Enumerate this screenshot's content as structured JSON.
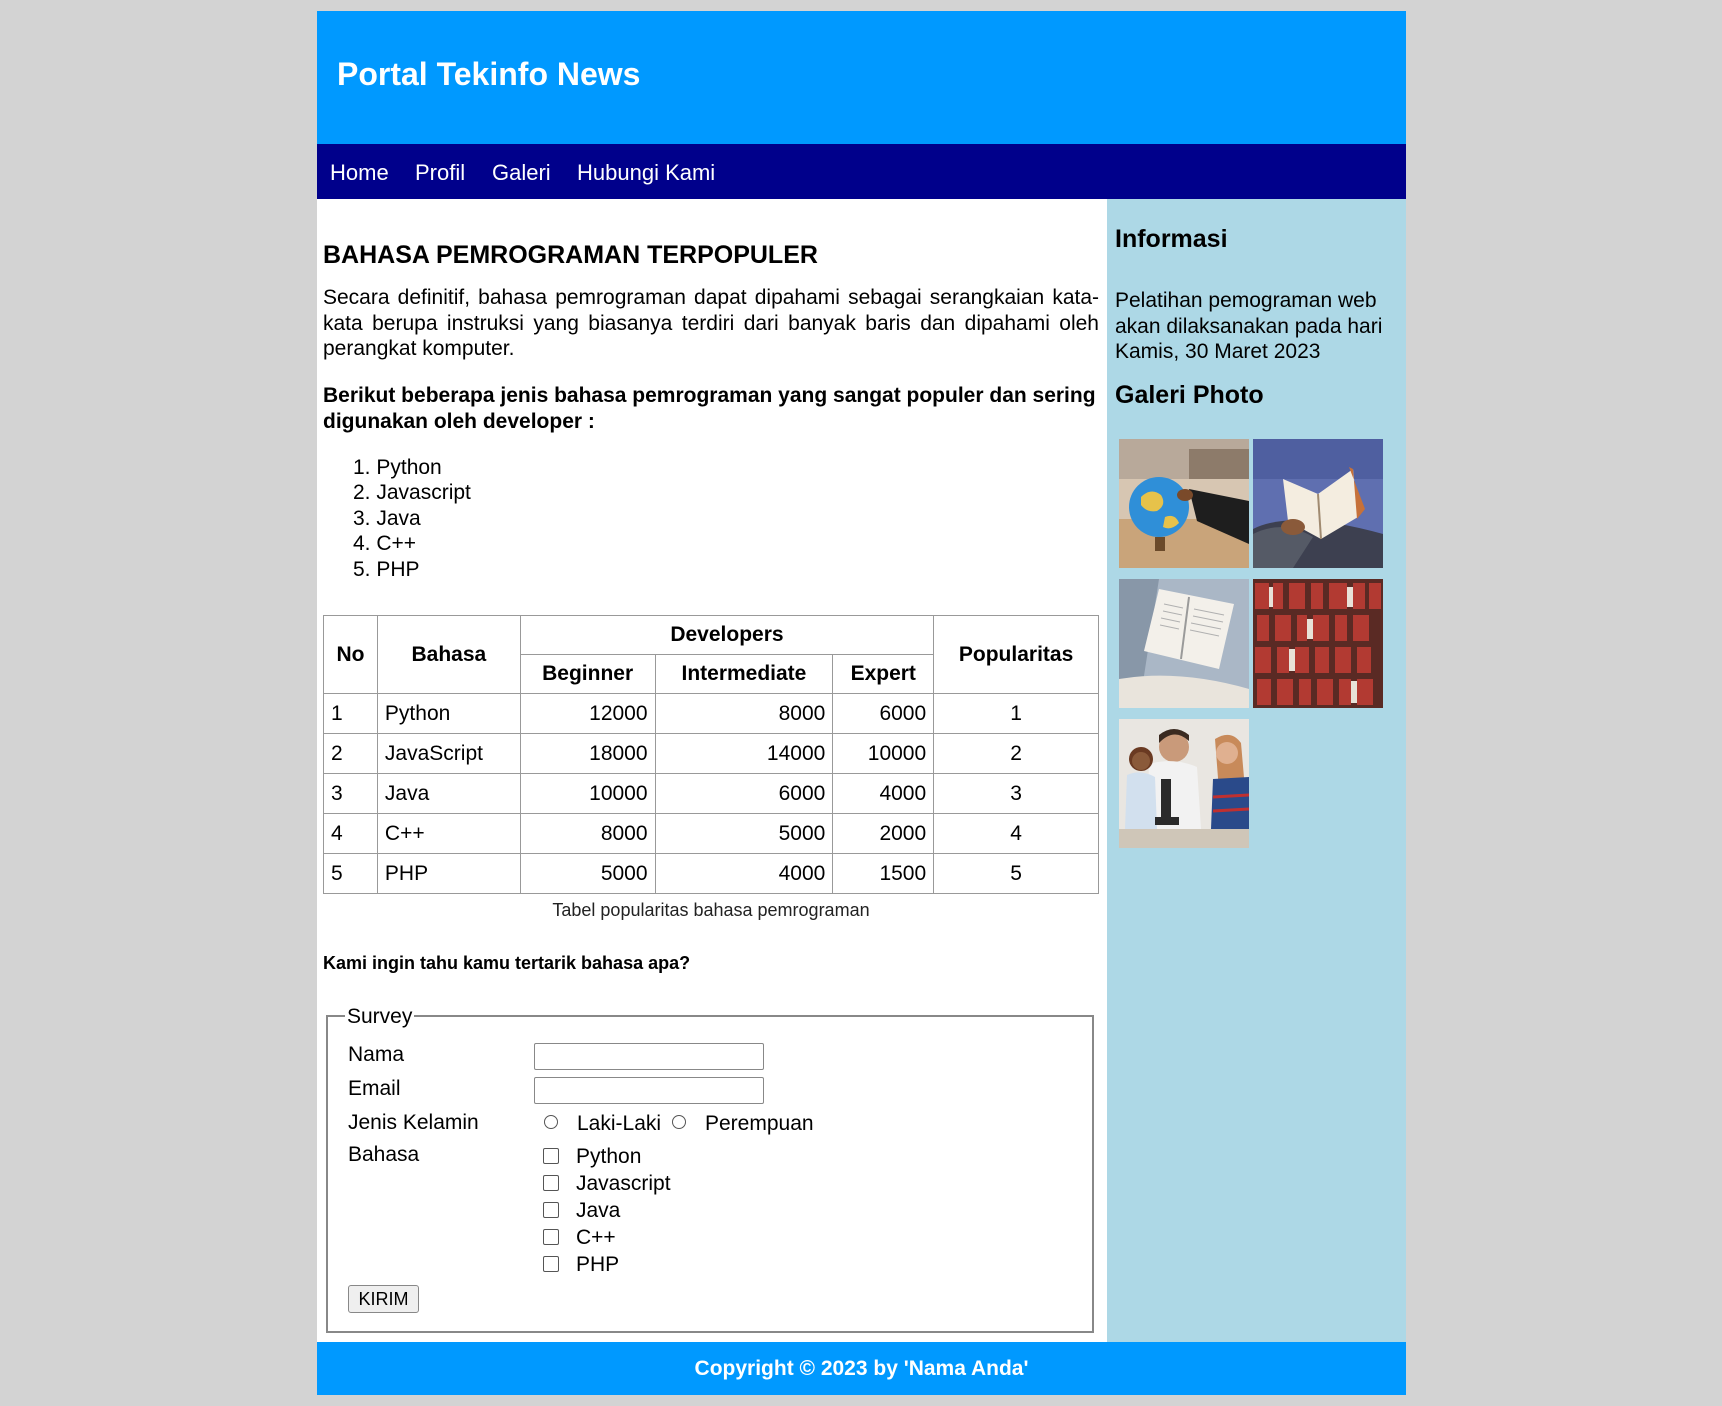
{
  "header": {
    "title": "Portal Tekinfo News"
  },
  "nav": {
    "items": [
      "Home",
      "Profil",
      "Galeri",
      "Hubungi Kami"
    ]
  },
  "article": {
    "title": "BAHASA PEMROGRAMAN TERPOPULER",
    "intro": "Secara definitif, bahasa pemrograman dapat dipahami sebagai serangkaian kata-kata berupa instruksi yang biasanya terdiri dari banyak baris dan dipahami oleh perangkat komputer.",
    "lead": "Berikut beberapa jenis bahasa pemrograman yang sangat populer dan sering digunakan oleh developer :",
    "list": [
      "1. Python",
      "2. Javascript",
      "3. Java",
      "4. C++",
      "5. PHP"
    ]
  },
  "table": {
    "headers": {
      "no": "No",
      "bahasa": "Bahasa",
      "developers": "Developers",
      "beginner": "Beginner",
      "intermediate": "Intermediate",
      "expert": "Expert",
      "popularitas": "Popularitas"
    },
    "rows": [
      {
        "no": "1",
        "bahasa": "Python",
        "beginner": "12000",
        "intermediate": "8000",
        "expert": "6000",
        "popularitas": "1"
      },
      {
        "no": "2",
        "bahasa": "JavaScript",
        "beginner": "18000",
        "intermediate": "14000",
        "expert": "10000",
        "popularitas": "2"
      },
      {
        "no": "3",
        "bahasa": "Java",
        "beginner": "10000",
        "intermediate": "6000",
        "expert": "4000",
        "popularitas": "3"
      },
      {
        "no": "4",
        "bahasa": "C++",
        "beginner": "8000",
        "intermediate": "5000",
        "expert": "2000",
        "popularitas": "4"
      },
      {
        "no": "5",
        "bahasa": "PHP",
        "beginner": "5000",
        "intermediate": "4000",
        "expert": "1500",
        "popularitas": "5"
      }
    ],
    "caption": "Tabel popularitas bahasa pemrograman"
  },
  "survey": {
    "question": "Kami ingin tahu kamu tertarik bahasa apa?",
    "legend": "Survey",
    "nama_label": "Nama",
    "nama_value": "",
    "email_label": "Email",
    "email_value": "",
    "gender_label": "Jenis Kelamin",
    "gender_options": [
      "Laki-Laki",
      "Perempuan"
    ],
    "bahasa_label": "Bahasa",
    "bahasa_options": [
      "Python",
      "Javascript",
      "Java",
      "C++",
      "PHP"
    ],
    "submit_label": "KIRIM"
  },
  "sidebar": {
    "info_title": "Informasi",
    "info_text": "Pelatihan pemograman web akan dilaksanakan pada hari Kamis, 30 Maret 2023",
    "gallery_title": "Galeri Photo",
    "photos": [
      "globe-photo",
      "reading-book-photo",
      "open-book-photo",
      "bookshelf-photo",
      "microscope-class-photo"
    ]
  },
  "footer": {
    "text": "Copyright © 2023 by 'Nama Anda'"
  },
  "colors": {
    "header": "#0099ff",
    "nav": "#00008b",
    "sidebar": "#add8e6",
    "background": "#d3d3d3"
  }
}
